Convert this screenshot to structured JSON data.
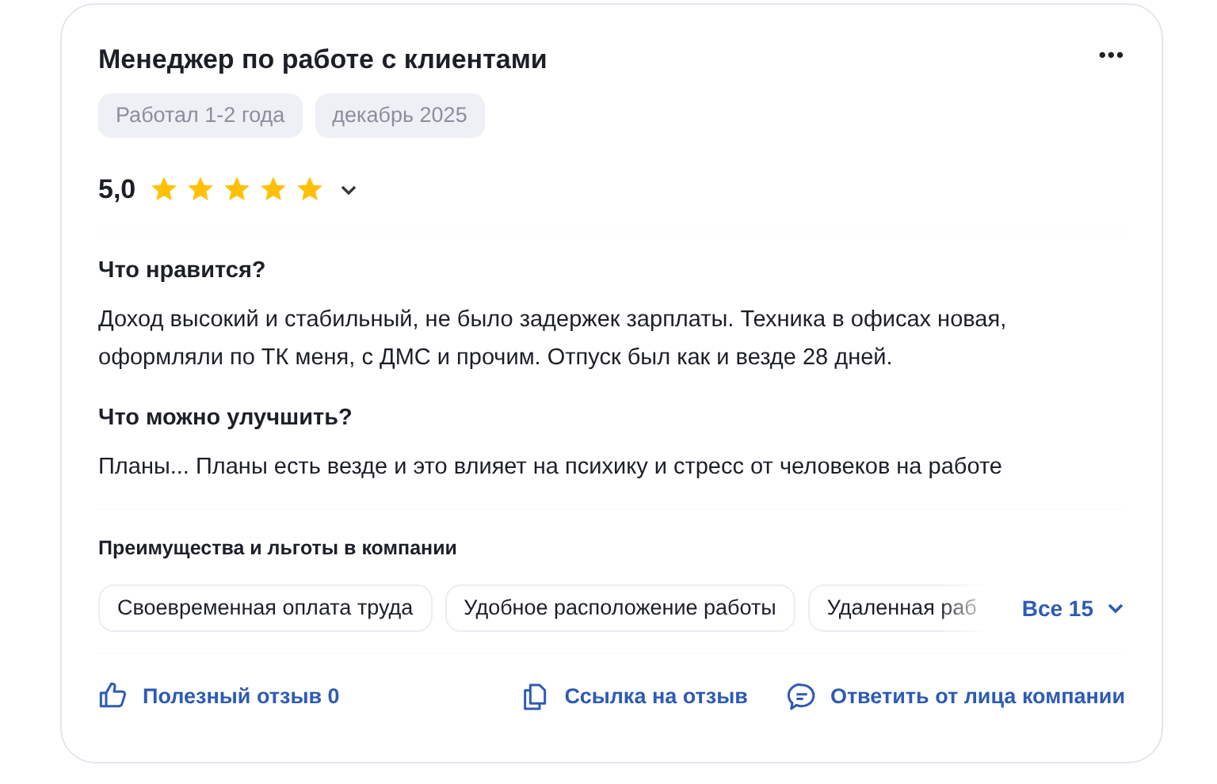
{
  "review": {
    "title": "Менеджер по работе с клиентами",
    "menu_icon": "•••",
    "tags": [
      "Работал 1-2 года",
      "декабрь 2025"
    ],
    "rating": "5,0",
    "stars": 5,
    "sections": [
      {
        "heading": "Что нравится?",
        "text": "Доход высокий и стабильный, не было задержек зарплаты. Техника в офисах новая, оформляли по ТК меня, с ДМС и прочим. Отпуск был как и везде 28 дней."
      },
      {
        "heading": "Что можно улучшить?",
        "text": "Планы... Планы есть везде и это влияет на психику и стресс от человеков на работе"
      }
    ],
    "benefits": {
      "heading": "Преимущества и льготы в компании",
      "items": [
        "Своевременная оплата труда",
        "Удобное расположение работы",
        "Удаленная раб"
      ],
      "more": "Все 15"
    },
    "actions": [
      {
        "kind": "like",
        "label": "Полезный отзыв 0"
      },
      {
        "kind": "link",
        "label": "Ссылка на отзыв"
      },
      {
        "kind": "reply",
        "label": "Ответить от лица компании"
      }
    ]
  }
}
